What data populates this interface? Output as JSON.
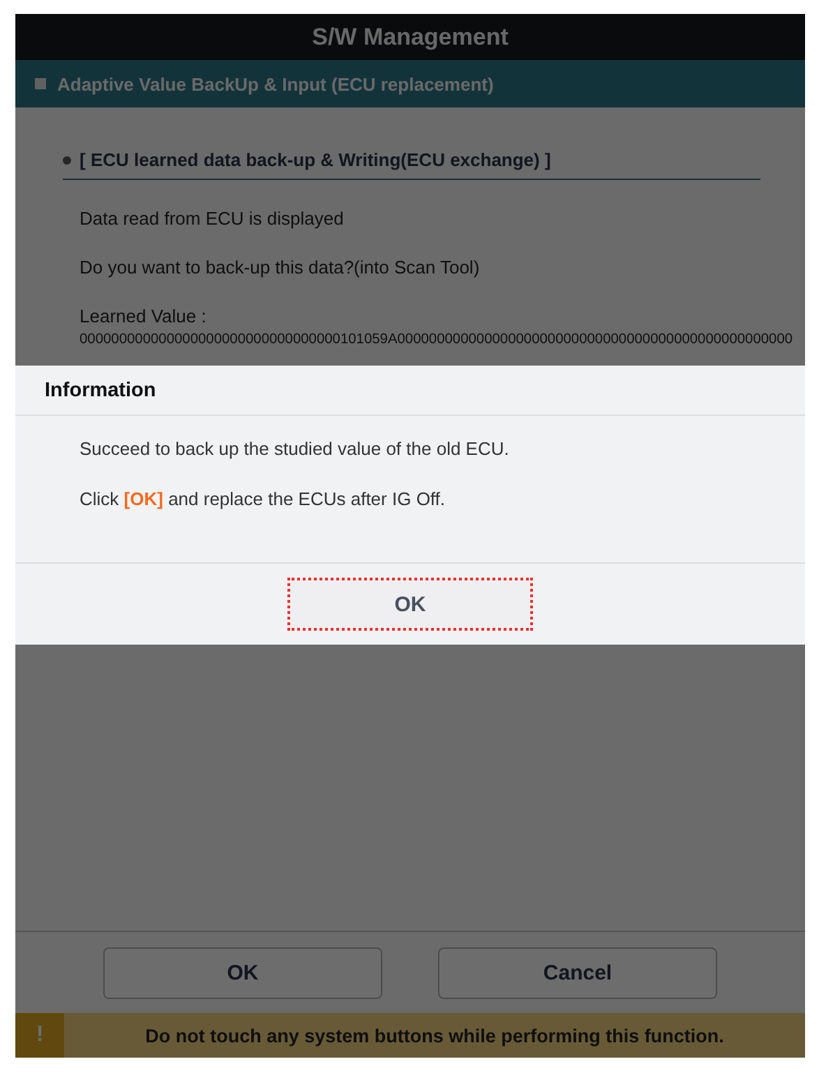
{
  "window": {
    "title": "S/W Management"
  },
  "section_header": {
    "text": "Adaptive Value BackUp & Input (ECU replacement)"
  },
  "content": {
    "heading": "[ ECU learned data back-up & Writing(ECU exchange) ]",
    "lines": [
      "Data read from ECU is displayed",
      "Do you want to back-up this data?(into Scan Tool)"
    ],
    "learned_label": "Learned Value :",
    "learned_value": "000000000000000000000000000000000101059A00000000000000000000000000000000000000000000000000"
  },
  "buttons": [
    {
      "label": "OK"
    },
    {
      "label": "Cancel"
    }
  ],
  "warning": {
    "icon": "!",
    "text": "Do not touch any system buttons while performing this function."
  },
  "dialog": {
    "title": "Information",
    "lines": [
      "Succeed to back up the studied value of the old ECU.",
      "Click **[OK]** and replace the ECUs after IG Off."
    ],
    "button": {
      "label": "OK",
      "focused": true
    }
  }
}
